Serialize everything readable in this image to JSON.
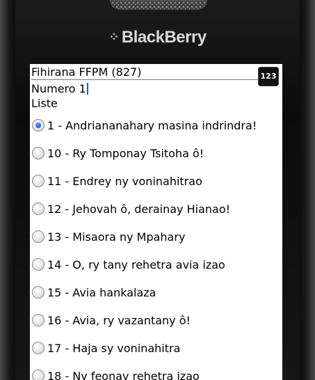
{
  "device": {
    "brand": "BlackBerry"
  },
  "screen": {
    "title": "Fihirana FFPM (827)",
    "input_mode": "123",
    "number_label": "Numero",
    "number_value": "1",
    "list_label": "Liste",
    "items": [
      {
        "label": "1 - Andriananahary masina indrindra!",
        "selected": true
      },
      {
        "label": "10 - Ry Tomponay Tsitoha ô!",
        "selected": false
      },
      {
        "label": "11 - Endrey ny voninahitrao",
        "selected": false
      },
      {
        "label": "12 - Jehovah ô, derainay Hianao!",
        "selected": false
      },
      {
        "label": "13 - Misaora ny Mpahary",
        "selected": false
      },
      {
        "label": "14 - O, ry tany rehetra avia izao",
        "selected": false
      },
      {
        "label": "15 - Avia hankalaza",
        "selected": false
      },
      {
        "label": "16 - Avia, ry vazantany ô!",
        "selected": false
      },
      {
        "label": "17 - Haja sy voninahitra",
        "selected": false
      },
      {
        "label": "18 - Ny feonay rehetra izao",
        "selected": false
      }
    ]
  },
  "colors": {
    "accent": "#1a5fd0",
    "screen_bg": "#ffffff",
    "bezel": "#111111"
  }
}
